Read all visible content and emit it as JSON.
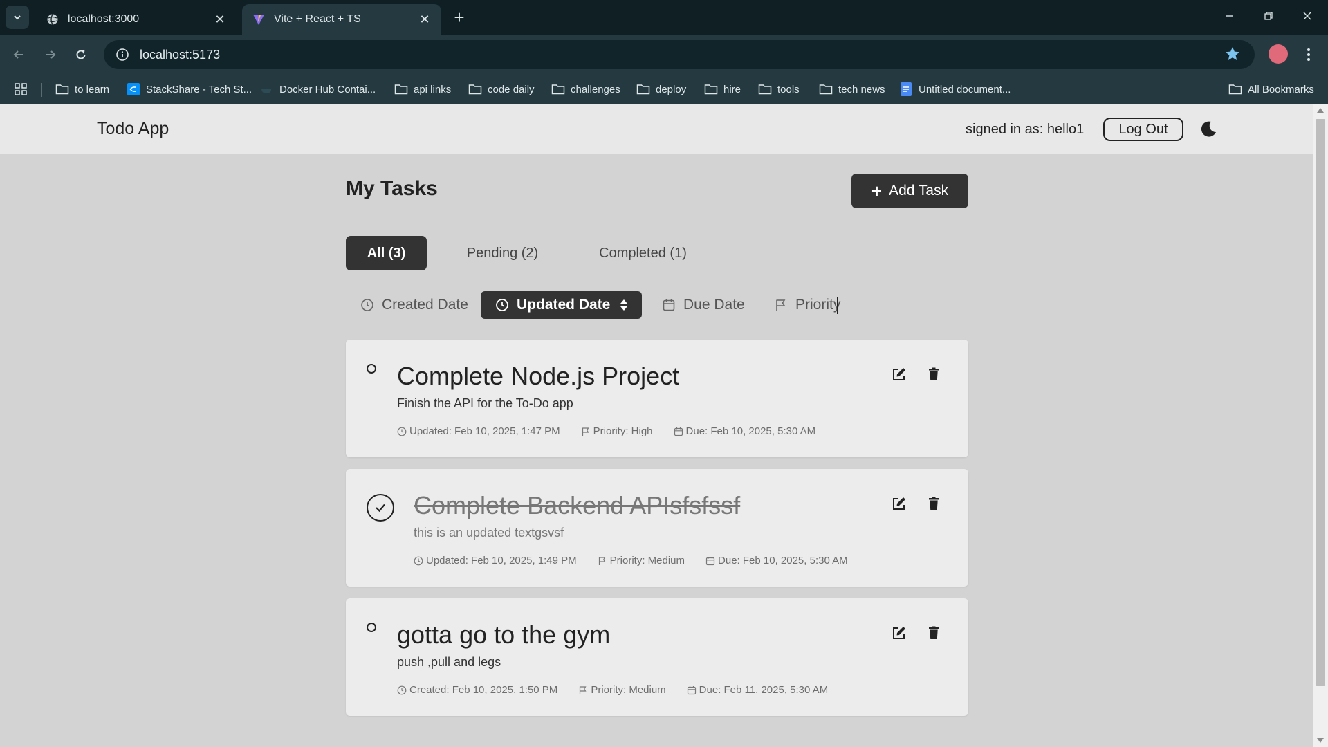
{
  "browser": {
    "tabs": [
      {
        "title": "localhost:3000"
      },
      {
        "title": "Vite + React + TS"
      }
    ],
    "url": "localhost:5173",
    "bookmarks": [
      {
        "label": "to learn",
        "icon": "folder-icon"
      },
      {
        "label": "StackShare - Tech St...",
        "icon": "stackshare-icon"
      },
      {
        "label": "Docker Hub Contai...",
        "icon": "docker-icon"
      },
      {
        "label": "api links",
        "icon": "folder-icon"
      },
      {
        "label": "code daily",
        "icon": "folder-icon"
      },
      {
        "label": "challenges",
        "icon": "folder-icon"
      },
      {
        "label": "deploy",
        "icon": "folder-icon"
      },
      {
        "label": "hire",
        "icon": "folder-icon"
      },
      {
        "label": "tools",
        "icon": "folder-icon"
      },
      {
        "label": "tech news",
        "icon": "folder-icon"
      },
      {
        "label": "Untitled document...",
        "icon": "docs-icon"
      }
    ],
    "all_bookmarks_label": "All Bookmarks"
  },
  "header": {
    "brand": "Todo App",
    "signed_in": "signed in as: hello1",
    "logout_label": "Log Out"
  },
  "main": {
    "title": "My Tasks",
    "add_task_label": "Add Task",
    "filters": [
      {
        "label": "All (3)",
        "active": true
      },
      {
        "label": "Pending (2)",
        "active": false
      },
      {
        "label": "Completed (1)",
        "active": false
      }
    ],
    "sort": [
      {
        "label": "Created Date",
        "icon": "clock-icon",
        "active": false
      },
      {
        "label": "Updated Date",
        "icon": "clock-icon",
        "active": true
      },
      {
        "label": "Due Date",
        "icon": "calendar-icon",
        "active": false
      },
      {
        "label": "Priority",
        "icon": "flag-icon",
        "active": false
      }
    ],
    "tasks": [
      {
        "title": "Complete Node.js Project",
        "description": "Finish the API for the To-Do app",
        "completed": false,
        "date_text": "Updated: Feb 10, 2025, 1:47 PM",
        "priority_text": "Priority: High",
        "due_text": "Due: Feb 10, 2025, 5:30 AM"
      },
      {
        "title": "Complete Backend APIsfsfssf",
        "description": "this is an updated textgsvsf",
        "completed": true,
        "date_text": "Updated: Feb 10, 2025, 1:49 PM",
        "priority_text": "Priority: Medium",
        "due_text": "Due: Feb 10, 2025, 5:30 AM"
      },
      {
        "title": "gotta go to the gym",
        "description": "push ,pull and legs",
        "completed": false,
        "date_text": "Created: Feb 10, 2025, 1:50 PM",
        "priority_text": "Priority: Medium",
        "due_text": "Due: Feb 11, 2025, 5:30 AM"
      }
    ]
  },
  "colors": {
    "page_bg": "#d3d3d3",
    "header_bg": "#e8e8e8",
    "card_bg": "#ececec",
    "dark_button": "#333333",
    "chrome_dark": "#0f1f24",
    "chrome_toolbar": "#243a40",
    "bookmark_star": "#7cc3f0"
  }
}
